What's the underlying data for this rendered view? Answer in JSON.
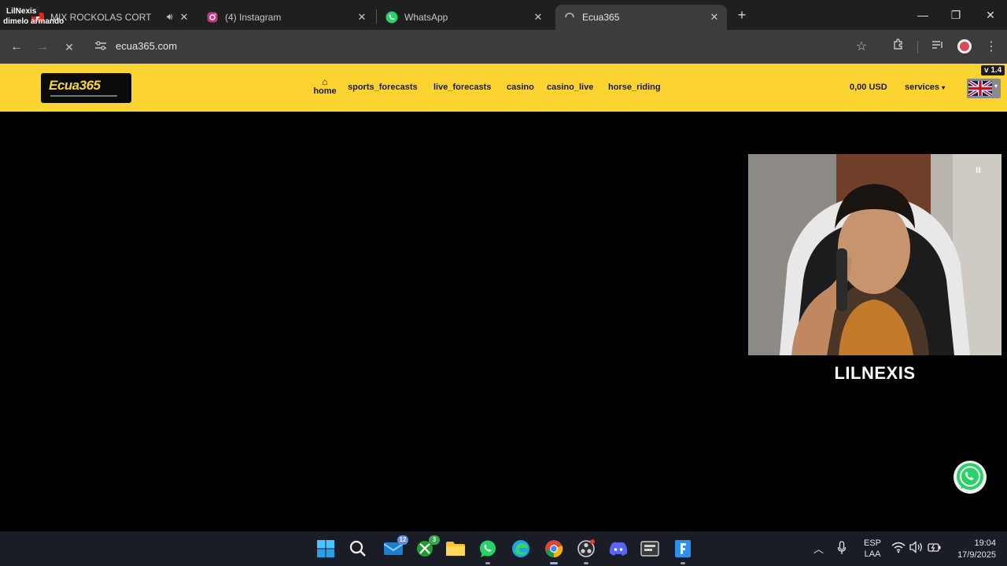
{
  "streamer": {
    "name": "LilNexis",
    "now_playing": "dimelo armando"
  },
  "tabs": [
    {
      "title": "MIX ROCKOLAS CORTA VENAS",
      "icon": "youtube-icon",
      "audio": true
    },
    {
      "title": "(4) Instagram",
      "icon": "instagram-icon"
    },
    {
      "title": "WhatsApp",
      "icon": "whatsapp-icon"
    },
    {
      "title": "Ecua365",
      "icon": "site-favicon",
      "active": true
    }
  ],
  "address_bar": {
    "url": "ecua365.com"
  },
  "site": {
    "logo_text": "Ecua365",
    "nav": {
      "home": "home",
      "sports_forecasts": "sports_forecasts",
      "live_forecasts": "live_forecasts",
      "casino": "casino",
      "casino_live": "casino_live",
      "horse_riding": "horse_riding"
    },
    "balance": "0,00 USD",
    "services": "services",
    "version": "v 1.4"
  },
  "overlay": {
    "cam_label": "LILNEXIS"
  },
  "taskbar": {
    "mail_badge": "12",
    "xbox_badge": "3",
    "language": "ESP",
    "layout": "LAA",
    "time": "19:04",
    "date": "17/9/2025"
  },
  "colors": {
    "brand_yellow": "#fcd431",
    "chrome_dark": "#1f1f1f",
    "toolbar": "#3c3c3c",
    "taskbar": "#1a1d26"
  }
}
